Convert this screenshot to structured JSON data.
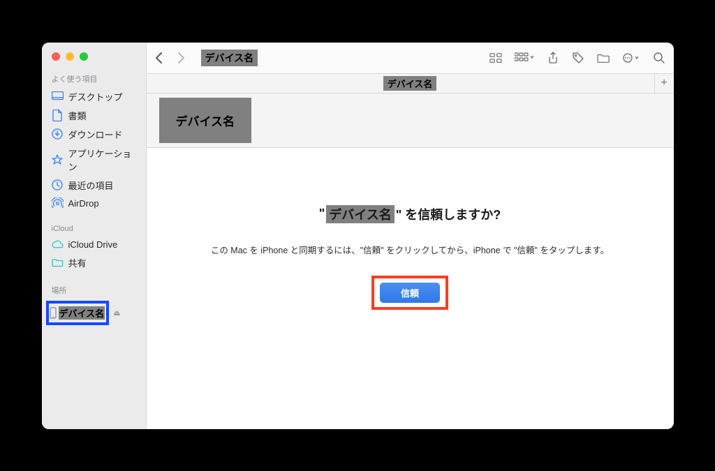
{
  "toolbar": {
    "title_chip": "デバイス名",
    "tab_chip": "デバイス名"
  },
  "sidebar": {
    "favorites_header": "よく使う項目",
    "favorites": [
      {
        "icon": "desktop",
        "label": "デスクトップ"
      },
      {
        "icon": "doc",
        "label": "書類"
      },
      {
        "icon": "download",
        "label": "ダウンロード"
      },
      {
        "icon": "app",
        "label": "アプリケーション"
      },
      {
        "icon": "clock",
        "label": "最近の項目"
      },
      {
        "icon": "airdrop",
        "label": "AirDrop"
      }
    ],
    "icloud_header": "iCloud",
    "icloud": [
      {
        "icon": "cloud",
        "label": "iCloud Drive"
      },
      {
        "icon": "folder",
        "label": "共有"
      }
    ],
    "locations_header": "場所",
    "device_chip": "デバイス名"
  },
  "header": {
    "device_chip": "デバイス名"
  },
  "trust": {
    "quote_open": "\"",
    "chip": "デバイス名",
    "quote_close_and_text": "\" を信頼しますか?",
    "body": "この Mac を iPhone と同期するには、\"信頼\" をクリックしてから、iPhone で \"信頼\" をタップします。",
    "button": "信頼"
  }
}
